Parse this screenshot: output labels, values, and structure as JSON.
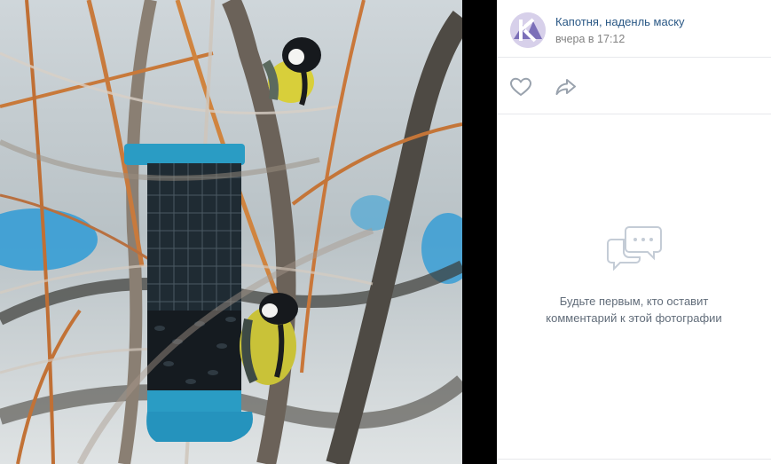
{
  "owner": {
    "name": "Капотня, наденль маску",
    "date": "вчера в 17:12"
  },
  "comments": {
    "empty_line1": "Будьте первым, кто оставит",
    "empty_line2": "комментарий к этой фотографии"
  },
  "icons": {
    "like": "heart-icon",
    "share": "share-arrow-icon",
    "empty": "comment-bubble-icon"
  },
  "colors": {
    "link": "#2a5885",
    "muted": "#828282",
    "icon": "#99a2ad"
  }
}
